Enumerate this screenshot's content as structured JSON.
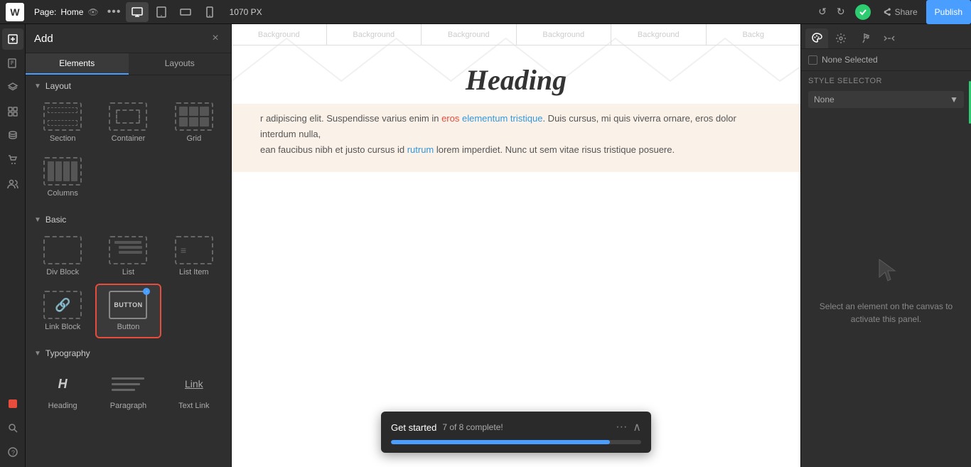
{
  "topbar": {
    "logo": "W",
    "page_label": "Page:",
    "page_name": "Home",
    "view_label": "1070 PX",
    "undo_label": "↺",
    "redo_label": "↻",
    "share_label": "Share",
    "publish_label": "Publish",
    "dots_icon": "•••"
  },
  "add_panel": {
    "title": "Add",
    "close_icon": "×",
    "tabs": [
      {
        "label": "Elements",
        "active": true
      },
      {
        "label": "Layouts",
        "active": false
      }
    ],
    "layout_section": {
      "title": "Layout",
      "items": [
        {
          "id": "section",
          "label": "Section"
        },
        {
          "id": "container",
          "label": "Container"
        },
        {
          "id": "grid",
          "label": "Grid"
        },
        {
          "id": "columns",
          "label": "Columns"
        }
      ]
    },
    "basic_section": {
      "title": "Basic",
      "items": [
        {
          "id": "div-block",
          "label": "Div Block"
        },
        {
          "id": "list",
          "label": "List"
        },
        {
          "id": "list-item",
          "label": "List Item"
        },
        {
          "id": "link-block",
          "label": "Link Block"
        },
        {
          "id": "button",
          "label": "Button",
          "selected": true
        }
      ]
    },
    "typography_section": {
      "title": "Typography",
      "items": [
        {
          "id": "heading",
          "label": "Heading"
        },
        {
          "id": "paragraph",
          "label": "Paragraph"
        },
        {
          "id": "text-link",
          "label": "Text Link"
        }
      ]
    }
  },
  "canvas": {
    "heading": "Heading",
    "bg_labels": [
      "Background",
      "Background",
      "Background",
      "Background",
      "Background",
      "Backg"
    ],
    "body_text": "r adipiscing elit. Suspendisse varius enim in eros elementum tristique. Duis cursus, mi quis viverra ornare, eros dolor interdum nulla, ean faucibus nibh et justo cursus id rutrum lorem imperdiet. Nunc ut sem vitae risus tristique posuere.",
    "highlight_words": [
      "elementum tristique",
      "rutrum"
    ]
  },
  "progress": {
    "title": "Get started",
    "count_label": "7 of 8 complete!",
    "dots": "···",
    "collapse": "∧",
    "percent": 87.5
  },
  "right_panel": {
    "none_selected_label": "None Selected",
    "style_selector_label": "Style selector",
    "none_dropdown": "None",
    "empty_message": "Select an element on the canvas to activate this panel.",
    "tabs": [
      "brush",
      "gear",
      "water",
      "bolt"
    ]
  }
}
